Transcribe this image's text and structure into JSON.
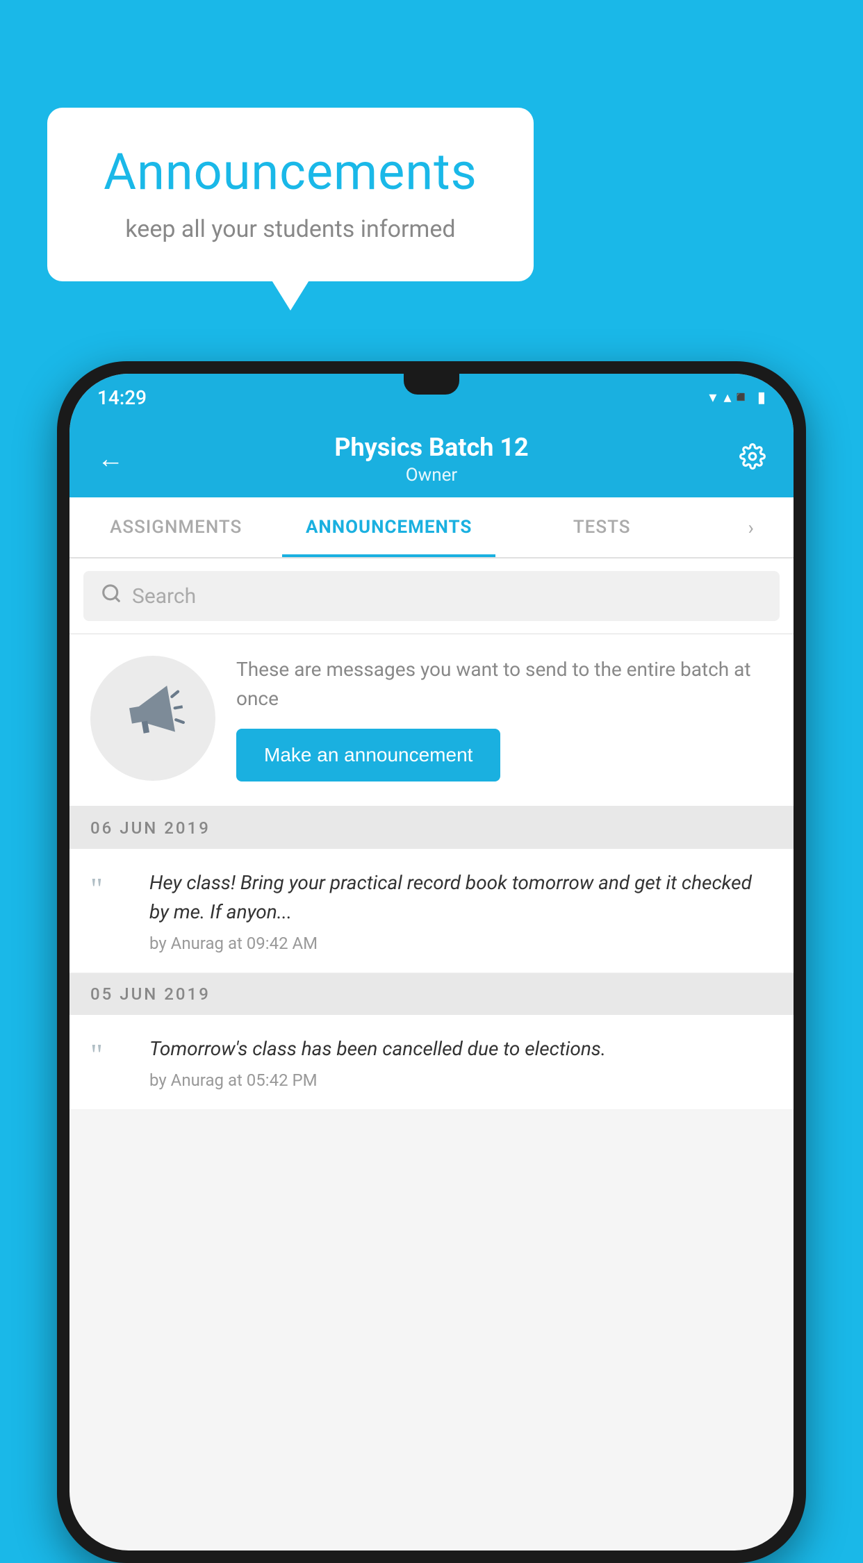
{
  "background_color": "#1ab8e8",
  "speech_bubble": {
    "title": "Announcements",
    "subtitle": "keep all your students informed"
  },
  "status_bar": {
    "time": "14:29",
    "wifi": "▼",
    "signal": "▲",
    "battery": "▮"
  },
  "header": {
    "title": "Physics Batch 12",
    "subtitle": "Owner",
    "back_label": "←",
    "settings_label": "⚙"
  },
  "tabs": [
    {
      "label": "ASSIGNMENTS",
      "active": false
    },
    {
      "label": "ANNOUNCEMENTS",
      "active": true
    },
    {
      "label": "TESTS",
      "active": false
    }
  ],
  "search": {
    "placeholder": "Search",
    "icon": "🔍"
  },
  "announcement_prompt": {
    "description": "These are messages you want to send to the entire batch at once",
    "button_label": "Make an announcement"
  },
  "date_sections": [
    {
      "date": "06  JUN  2019",
      "items": [
        {
          "text": "Hey class! Bring your practical record book tomorrow and get it checked by me. If anyon...",
          "meta": "by Anurag at 09:42 AM"
        }
      ]
    },
    {
      "date": "05  JUN  2019",
      "items": [
        {
          "text": "Tomorrow's class has been cancelled due to elections.",
          "meta": "by Anurag at 05:42 PM"
        }
      ]
    }
  ]
}
